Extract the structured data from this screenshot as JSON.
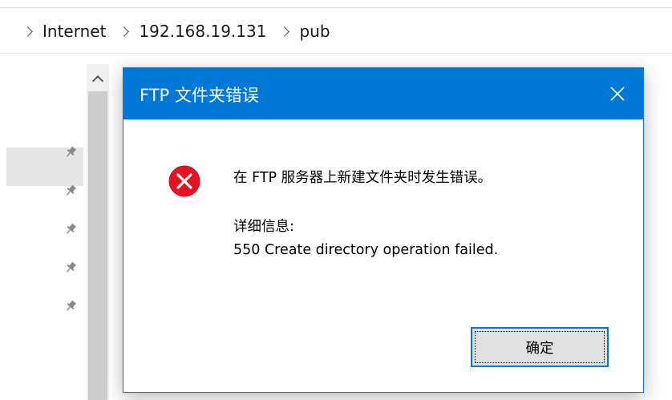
{
  "breadcrumb": {
    "items": [
      "Internet",
      "192.168.19.131",
      "pub"
    ]
  },
  "dialog": {
    "title": "FTP 文件夹错误",
    "message": "在 FTP 服务器上新建文件夹时发生错误。",
    "detail_label": "详细信息:",
    "detail": "550 Create directory operation failed.",
    "ok_label": "确定"
  },
  "icons": {
    "close": "close-icon",
    "error": "error-icon",
    "pin": "pin-icon",
    "breadcrumb_separator": "chevron-right-icon",
    "scroll_up": "chevron-up-icon"
  },
  "colors": {
    "title_bar": "#0078d7",
    "error_icon": "#e81123",
    "button_border": "#0078d7"
  }
}
